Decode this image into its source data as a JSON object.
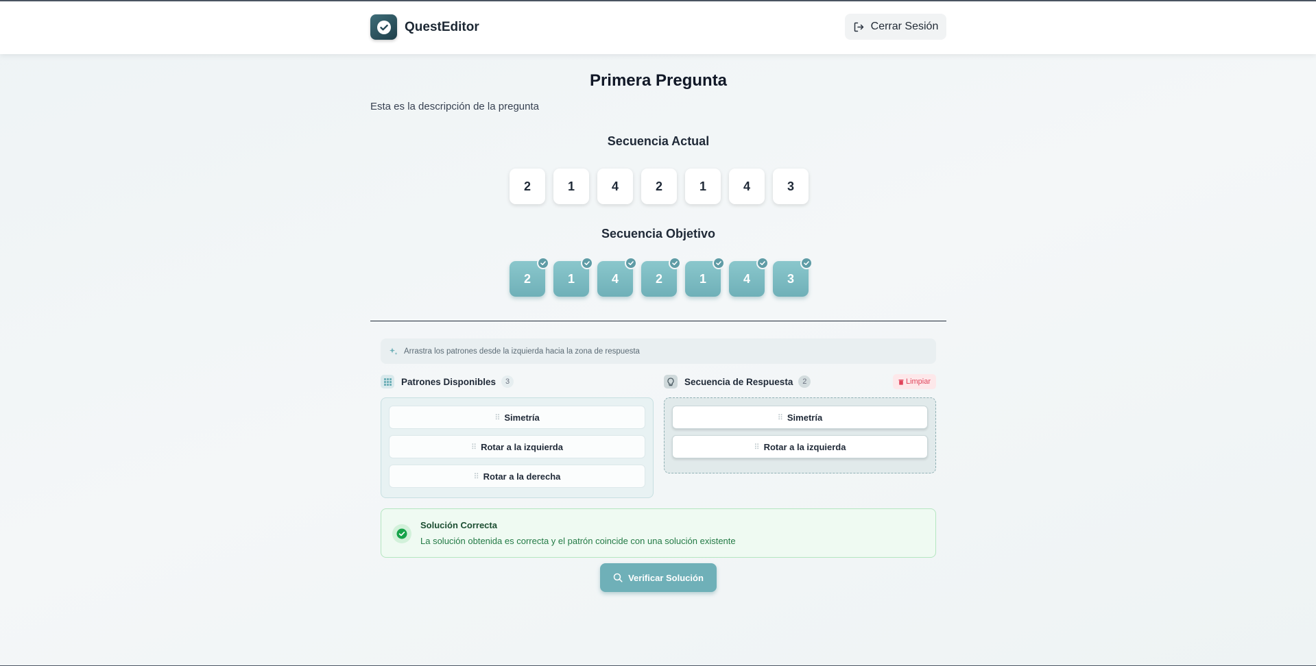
{
  "app": {
    "name": "QuestEditor",
    "logout_label": "Cerrar Sesión",
    "accent_color": "#6fb0b8"
  },
  "question": {
    "title": "Primera Pregunta",
    "description": "Esta es la descripción de la pregunta"
  },
  "current_sequence": {
    "heading": "Secuencia Actual",
    "values": [
      "2",
      "1",
      "4",
      "2",
      "1",
      "4",
      "3"
    ]
  },
  "target_sequence": {
    "heading": "Secuencia Objetivo",
    "values": [
      "2",
      "1",
      "4",
      "2",
      "1",
      "4",
      "3"
    ],
    "all_matched": true
  },
  "hint": {
    "text": "Arrastra los patrones desde la izquierda hacia la zona de respuesta",
    "icon": "sparkles-icon"
  },
  "available_patterns": {
    "title": "Patrones Disponibles",
    "count": "3",
    "items": [
      "Simetría",
      "Rotar a la izquierda",
      "Rotar a la derecha"
    ]
  },
  "answer_sequence": {
    "title": "Secuencia de Respuesta",
    "count": "2",
    "clear_label": "Limpiar",
    "items": [
      "Simetría",
      "Rotar a la izquierda"
    ]
  },
  "result": {
    "title": "Solución Correcta",
    "message": "La solución obtenida es correcta y el patrón coincide con una solución existente",
    "status_color": "#16a34a"
  },
  "verify_button_label": "Verificar Solución"
}
